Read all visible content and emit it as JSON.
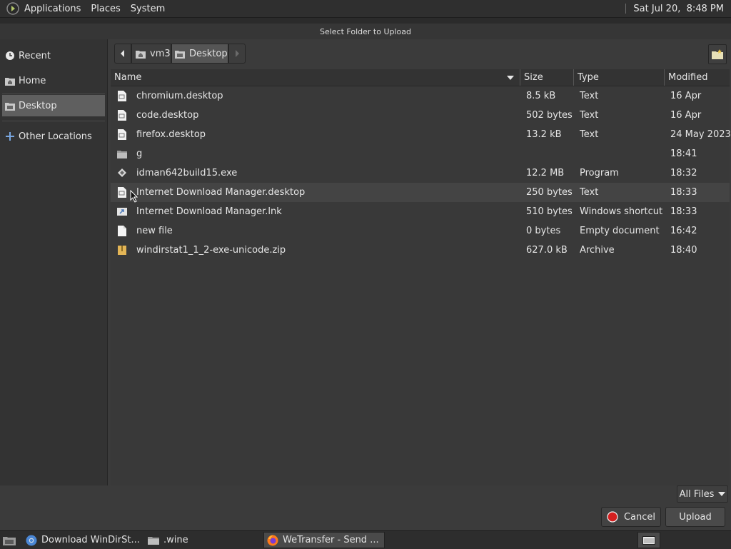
{
  "top_panel": {
    "menus": [
      "Applications",
      "Places",
      "System"
    ],
    "clock": "Sat Jul 20,  8:48 PM"
  },
  "dialog": {
    "title": "Select Folder to Upload",
    "sidebar": {
      "items": [
        {
          "label": "Recent",
          "icon": "clock-icon"
        },
        {
          "label": "Home",
          "icon": "home-folder-icon"
        },
        {
          "label": "Desktop",
          "icon": "desktop-folder-icon",
          "active": true
        },
        {
          "label": "Other Locations",
          "icon": "plus-icon"
        }
      ]
    },
    "path_bar": {
      "segments": [
        "vm3",
        "Desktop"
      ]
    },
    "columns": {
      "name": "Name",
      "size": "Size",
      "type": "Type",
      "modified": "Modified"
    },
    "files": [
      {
        "name": "chromium.desktop",
        "size": "8.5 kB",
        "type": "Text",
        "modified": "16 Apr",
        "icon": "desktop-file-icon"
      },
      {
        "name": "code.desktop",
        "size": "502 bytes",
        "type": "Text",
        "modified": "16 Apr",
        "icon": "desktop-file-icon"
      },
      {
        "name": "firefox.desktop",
        "size": "13.2 kB",
        "type": "Text",
        "modified": "24 May 2023",
        "icon": "desktop-file-icon"
      },
      {
        "name": "g",
        "size": "",
        "type": "",
        "modified": "18:41",
        "icon": "folder-icon"
      },
      {
        "name": "idman642build15.exe",
        "size": "12.2 MB",
        "type": "Program",
        "modified": "18:32",
        "icon": "executable-icon"
      },
      {
        "name": "Internet Download Manager.desktop",
        "size": "250 bytes",
        "type": "Text",
        "modified": "18:33",
        "icon": "desktop-file-icon"
      },
      {
        "name": "Internet Download Manager.lnk",
        "size": "510 bytes",
        "type": "Windows shortcut",
        "modified": "18:33",
        "icon": "shortcut-icon"
      },
      {
        "name": "new file",
        "size": "0 bytes",
        "type": "Empty document",
        "modified": "16:42",
        "icon": "blank-document-icon"
      },
      {
        "name": "windirstat1_1_2-exe-unicode.zip",
        "size": "627.0 kB",
        "type": "Archive",
        "modified": "18:40",
        "icon": "archive-icon"
      }
    ],
    "filter": "All Files",
    "cancel_label": "Cancel",
    "upload_label": "Upload"
  },
  "taskbar": {
    "items": [
      {
        "label": "Download WinDirSt...",
        "icon": "chromium-icon"
      },
      {
        "label": ".wine",
        "icon": "folder-icon"
      },
      {
        "label": "WeTransfer - Send ...",
        "icon": "firefox-icon",
        "active": true
      }
    ]
  }
}
